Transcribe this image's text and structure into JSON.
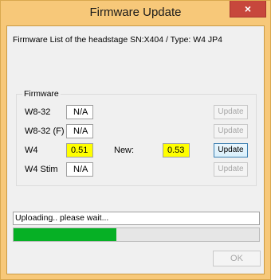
{
  "window": {
    "title": "Firmware Update",
    "close_glyph": "×"
  },
  "headline": "Firmware List of the headstage SN:X404 / Type: W4 JP4",
  "firmware_group": {
    "title": "Firmware",
    "new_label": "New:",
    "rows": [
      {
        "label": "W8-32",
        "current": "N/A",
        "new": "",
        "button": "Update",
        "button_enabled": false
      },
      {
        "label": "W8-32 (F)",
        "current": "N/A",
        "new": "",
        "button": "Update",
        "button_enabled": false
      },
      {
        "label": "W4",
        "current": "0.51",
        "new": "0.53",
        "button": "Update",
        "button_enabled": true
      },
      {
        "label": "W4 Stim",
        "current": "N/A",
        "new": "",
        "button": "Update",
        "button_enabled": false
      }
    ]
  },
  "status": {
    "text": "Uploading.. please wait...",
    "progress": 0.42
  },
  "ok_button": "OK",
  "colors": {
    "frame": "#f7c879",
    "close": "#c7473c",
    "highlight": "#ffff00",
    "progress": "#06b025"
  }
}
